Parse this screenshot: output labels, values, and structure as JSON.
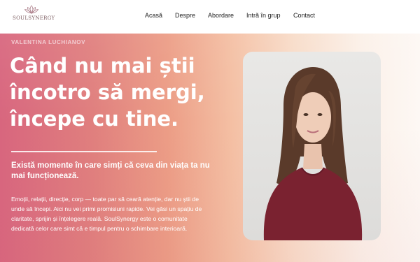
{
  "brand": {
    "name": "SOULSYNERGY",
    "logo_icon": "lotus-icon",
    "accent": "#b08590"
  },
  "nav": {
    "items": [
      "Acasă",
      "Despre",
      "Abordare",
      "Intră în grup",
      "Contact"
    ]
  },
  "hero": {
    "eyebrow": "VALENTINA LUCHIANOV",
    "headline": [
      "Când nu mai știi",
      "încotro să mergi,",
      "începe cu tine."
    ],
    "subhead": [
      "Există momente în care simți că ceva din viața ta nu",
      "mai funcționează."
    ],
    "body": [
      "Emoții, relații, direcție, corp — toate par să ceară atenție, dar nu știi de",
      "unde să începi. Aici nu vei primi promisiuni rapide. Vei găsi un spațiu de",
      "claritate, sprijin și înțelegere reală. SoulSynergy este o comunitate",
      "dedicată celor care simt că e timpul pentru o schimbare interioară."
    ],
    "gradient": [
      "#d8667e",
      "#ec9d86",
      "#f8dcc9",
      "#fdf8f4"
    ]
  },
  "photo": {
    "subject": "portrait-photo"
  }
}
